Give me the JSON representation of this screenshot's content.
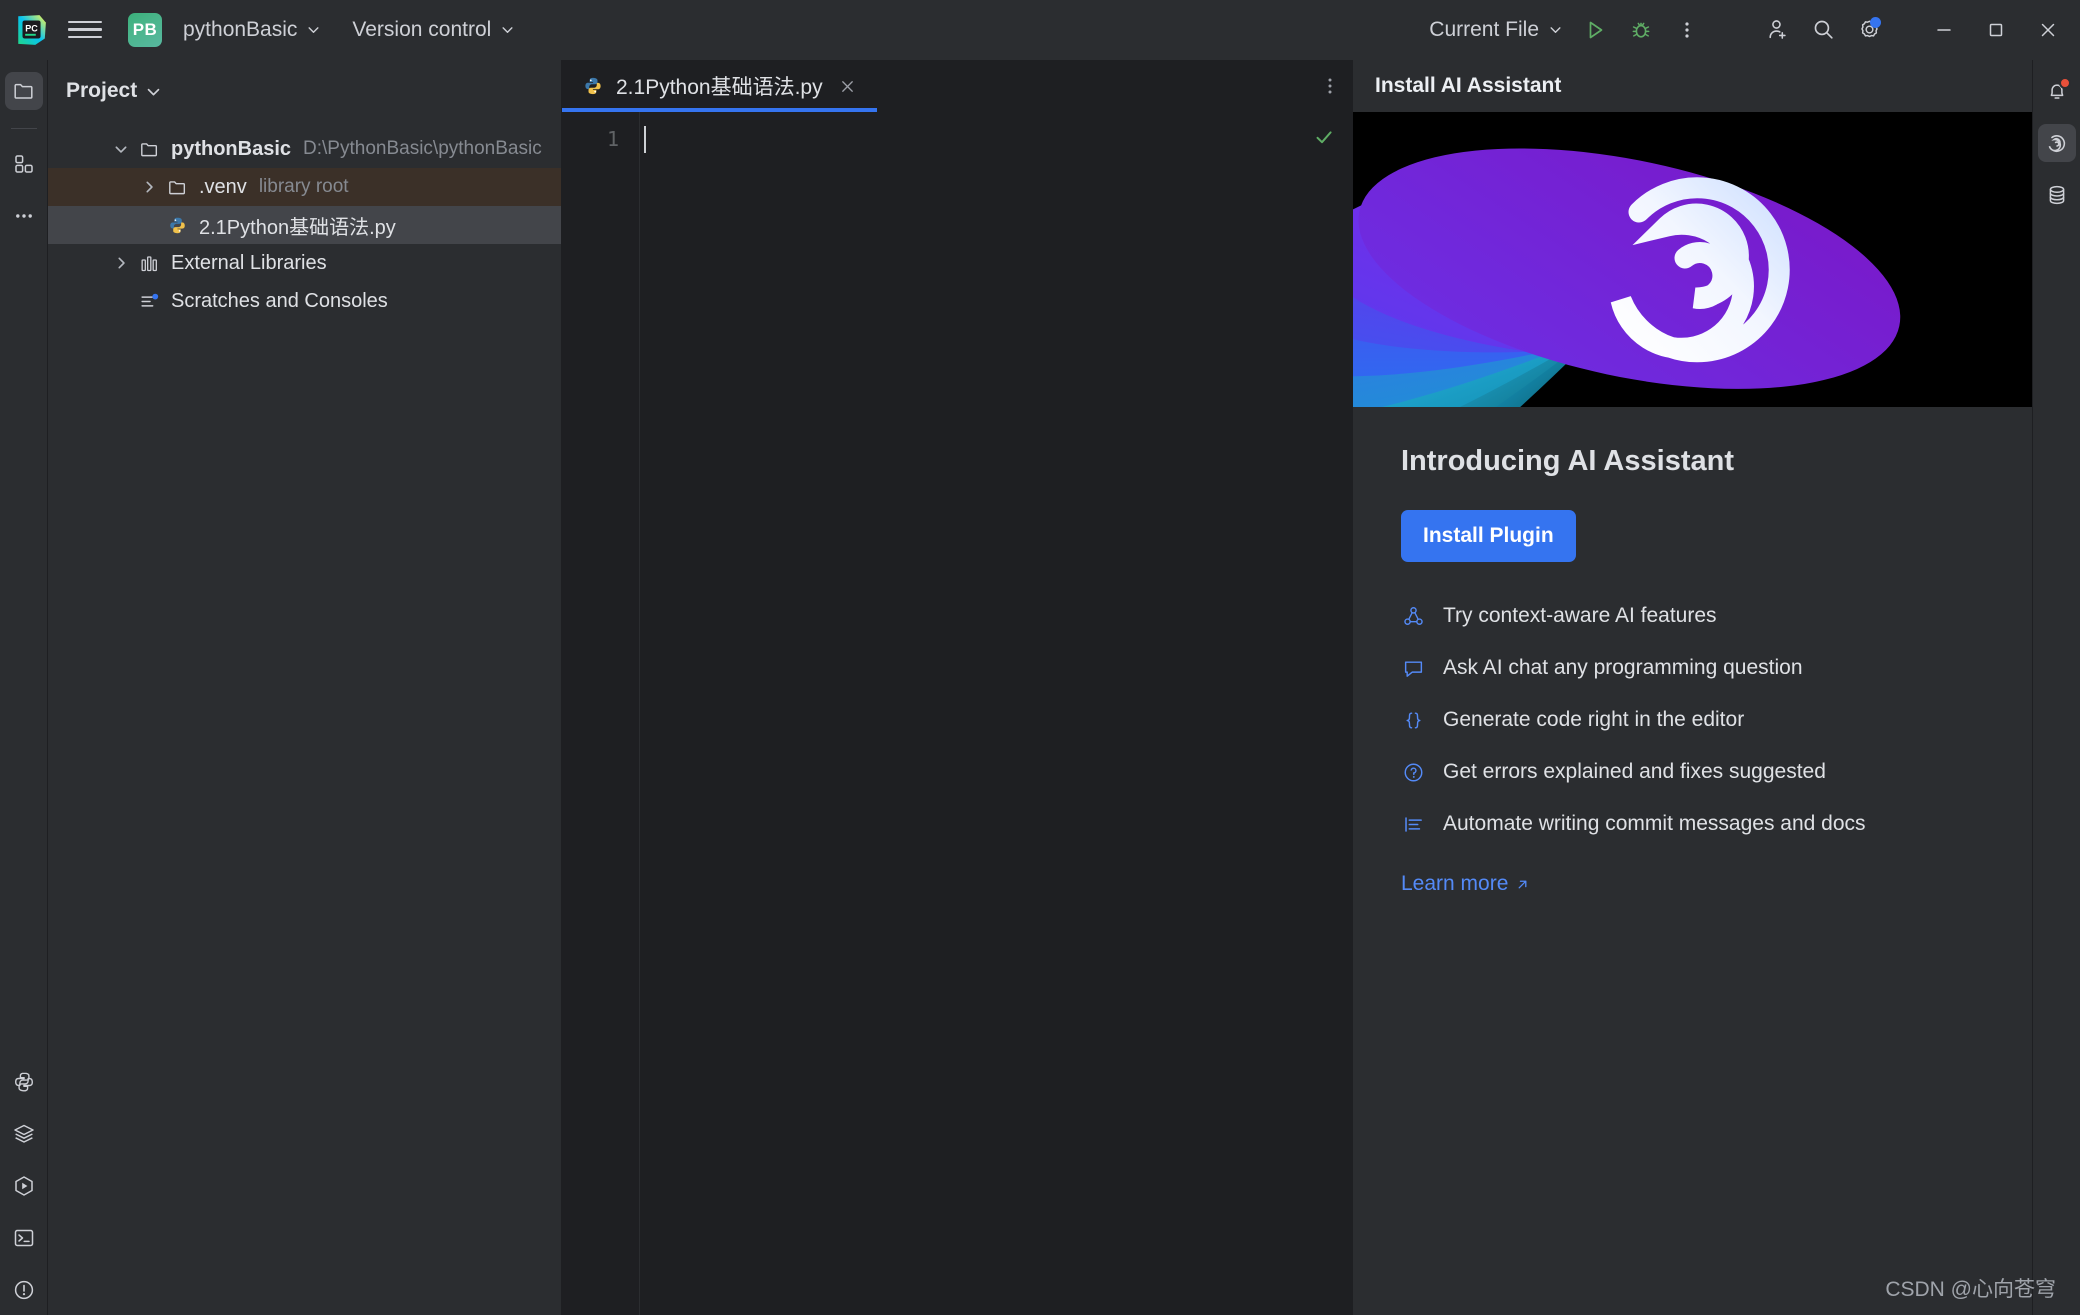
{
  "titlebar": {
    "app_logo": "pycharm-logo",
    "menu_icon": "hamburger-menu-icon",
    "project_badge": "PB",
    "project_name": "pythonBasic",
    "version_control": "Version control",
    "run_config": "Current File",
    "run_icon": "run-play-icon",
    "debug_icon": "debug-bug-icon",
    "more_icon": "more-vertical-icon",
    "account_icon": "add-user-icon",
    "search_icon": "search-icon",
    "settings_icon": "gear-icon",
    "minimize_icon": "minimize-icon",
    "maximize_icon": "maximize-icon",
    "close_icon": "close-icon"
  },
  "left_rail": {
    "top": [
      {
        "name": "project-tool-window",
        "icon": "folder-icon",
        "active": true
      },
      {
        "name": "plugins-tool-window",
        "icon": "grid-squares-icon",
        "active": false
      },
      {
        "name": "more-tool-windows",
        "icon": "ellipsis-icon",
        "active": false
      }
    ],
    "bottom": [
      {
        "name": "python-console",
        "icon": "python-icon"
      },
      {
        "name": "database-layers",
        "icon": "layers-icon"
      },
      {
        "name": "run-tool-window",
        "icon": "hexagon-play-icon"
      },
      {
        "name": "terminal-tool-window",
        "icon": "terminal-icon"
      },
      {
        "name": "problems-tool-window",
        "icon": "warning-circle-icon"
      }
    ]
  },
  "sidebar": {
    "title": "Project",
    "title_chevron": "chevron-down-icon",
    "tree": [
      {
        "label": "pythonBasic",
        "hint": "D:\\PythonBasic\\pythonBasic",
        "icon": "folder-icon",
        "twisty": "chevron-down-icon",
        "bold": true,
        "indent": 0,
        "state": "normal"
      },
      {
        "label": ".venv",
        "hint": "library root",
        "icon": "folder-icon",
        "twisty": "chevron-right-icon",
        "bold": false,
        "indent": 1,
        "state": "highlight"
      },
      {
        "label": "2.1Python基础语法.py",
        "hint": "",
        "icon": "python-file-icon",
        "twisty": "",
        "bold": false,
        "indent": 1,
        "state": "selected"
      },
      {
        "label": "External Libraries",
        "hint": "",
        "icon": "library-icon",
        "twisty": "chevron-right-icon",
        "bold": false,
        "indent": 0,
        "state": "normal"
      },
      {
        "label": "Scratches and Consoles",
        "hint": "",
        "icon": "scratches-icon",
        "twisty": "",
        "bold": false,
        "indent": 0,
        "state": "normal"
      }
    ]
  },
  "editor": {
    "tab": {
      "label": "2.1Python基础语法.py",
      "icon": "python-file-icon",
      "close_icon": "close-icon",
      "active": true
    },
    "options_icon": "more-vertical-icon",
    "line_numbers": [
      "1"
    ],
    "code_lines": [
      ""
    ],
    "inspection_icon": "checkmark-icon",
    "inspection_status": "ok"
  },
  "ai_panel": {
    "header_title": "Install AI Assistant",
    "banner_icon": "ai-assistant-spiral-logo",
    "heading": "Introducing AI Assistant",
    "install_button": "Install Plugin",
    "features": [
      {
        "icon": "ai-context-icon",
        "text": "Try context-aware AI features"
      },
      {
        "icon": "chat-bubble-icon",
        "text": "Ask AI chat any programming question"
      },
      {
        "icon": "braces-icon",
        "text": "Generate code right in the editor"
      },
      {
        "icon": "question-circle-icon",
        "text": "Get errors explained and fixes suggested"
      },
      {
        "icon": "commit-lines-icon",
        "text": "Automate writing commit messages and docs"
      }
    ],
    "learn_more": "Learn more",
    "learn_more_icon": "external-link-arrow-icon"
  },
  "right_rail": [
    {
      "name": "notifications",
      "icon": "bell-icon",
      "badge": true,
      "active": false
    },
    {
      "name": "ai-assistant",
      "icon": "ai-assistant-spiral-icon",
      "badge": false,
      "active": true
    },
    {
      "name": "database",
      "icon": "database-icon",
      "badge": false,
      "active": false
    }
  ],
  "watermark": "CSDN @心向苍穹",
  "colors": {
    "accent_blue": "#3574f0",
    "link_blue": "#548af7",
    "panel_bg": "#2b2d30",
    "editor_bg": "#1e1f22",
    "selection": "#43454a",
    "venv_highlight": "#3b3028",
    "run_green": "#5fad65",
    "badge_red": "#e8503a"
  }
}
